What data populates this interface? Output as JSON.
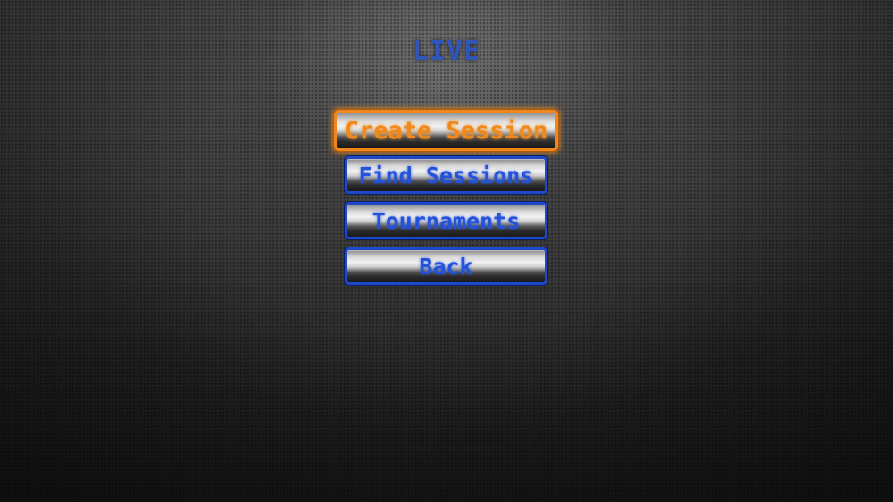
{
  "screen": {
    "title": "LIVE"
  },
  "menu": {
    "items": [
      {
        "label": "Create Session",
        "state": "selected"
      },
      {
        "label": "Find Sessions",
        "state": "normal"
      },
      {
        "label": "Tournaments",
        "state": "normal"
      },
      {
        "label": "Back",
        "state": "normal"
      }
    ]
  },
  "colors": {
    "title": "#2f56b8",
    "button_text": "#2452d8",
    "button_border": "#1f47c9",
    "selected_text": "#f08a1c",
    "selected_border": "#f0861c",
    "background": "#3a3a3a"
  }
}
